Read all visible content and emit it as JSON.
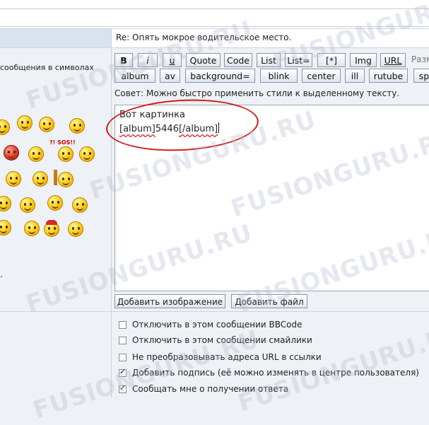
{
  "subject": "Re: Опять мокрое водительское место.",
  "left_hint": "сообщения в символах",
  "toolbar_row1": [
    "B",
    "i",
    "u",
    "Quote",
    "Code",
    "List",
    "List=",
    "[*]",
    "Img",
    "URL"
  ],
  "toolbar_row1_trailing": "Разм",
  "toolbar_row2": [
    "album",
    "av",
    "background=",
    "blink",
    "center",
    "ill",
    "rutube",
    "sp"
  ],
  "tip": "Совет: Можно быстро применить стили к выделенному тексту.",
  "editor": {
    "line1": "Вот картинка",
    "line2_open": "[album]",
    "line2_value": "5446",
    "line2_close": "[/album]"
  },
  "buttons": {
    "add_image": "Добавить изображение",
    "add_file": "Добавить файл"
  },
  "options": [
    {
      "label": "Отключить в этом сообщении BBCode",
      "checked": false
    },
    {
      "label": "Отключить в этом сообщении смайлики",
      "checked": false
    },
    {
      "label": "Не преобразовывать адреса URL в ссылки",
      "checked": false
    },
    {
      "label": "Добавить подпись (её можно изменять в центре пользователя)",
      "checked": true
    },
    {
      "label": "Сообщать мне о получении ответа",
      "checked": true
    }
  ],
  "smiley_sos_text": "?! SOS!!",
  "watermark": "FUSIONGURU.RU"
}
